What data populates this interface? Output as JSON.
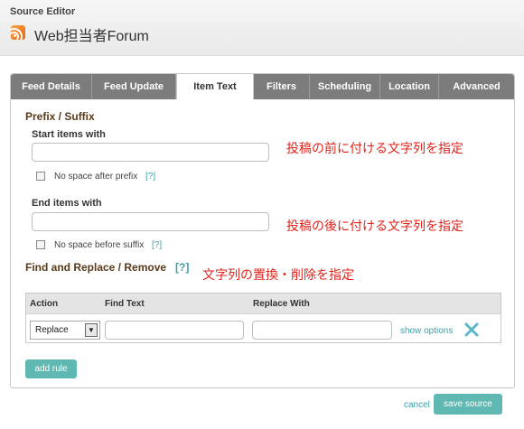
{
  "app": {
    "title": "Source Editor"
  },
  "feed": {
    "name": "Web担当者Forum",
    "icon": "rss-icon"
  },
  "tabs": [
    {
      "label": "Feed Details"
    },
    {
      "label": "Feed Update"
    },
    {
      "label": "Item Text",
      "active": true
    },
    {
      "label": "Filters"
    },
    {
      "label": "Scheduling"
    },
    {
      "label": "Location"
    },
    {
      "label": "Advanced"
    }
  ],
  "prefix_suffix": {
    "title": "Prefix / Suffix",
    "start_label": "Start items with",
    "start_value": "",
    "no_space_prefix": "No space after prefix",
    "end_label": "End items with",
    "end_value": "",
    "no_space_suffix": "No space before suffix",
    "help": "[?]"
  },
  "find_replace": {
    "title": "Find and Replace / Remove",
    "help": "[?]",
    "columns": {
      "action": "Action",
      "find": "Find Text",
      "replace": "Replace With"
    },
    "rule": {
      "action": "Replace",
      "find": "",
      "replace": "",
      "show_options": "show options"
    },
    "add_rule": "add rule"
  },
  "annotations": {
    "start": "投稿の前に付ける文字列を指定",
    "end": "投稿の後に付ける文字列を指定",
    "replace": "文字列の置換・削除を指定"
  },
  "footer": {
    "cancel": "cancel",
    "save": "save source"
  },
  "colors": {
    "accent": "#5fb8b1",
    "tabbar": "#7c7c7c",
    "annotation": "#e0241b",
    "link": "#3aa0a8"
  }
}
